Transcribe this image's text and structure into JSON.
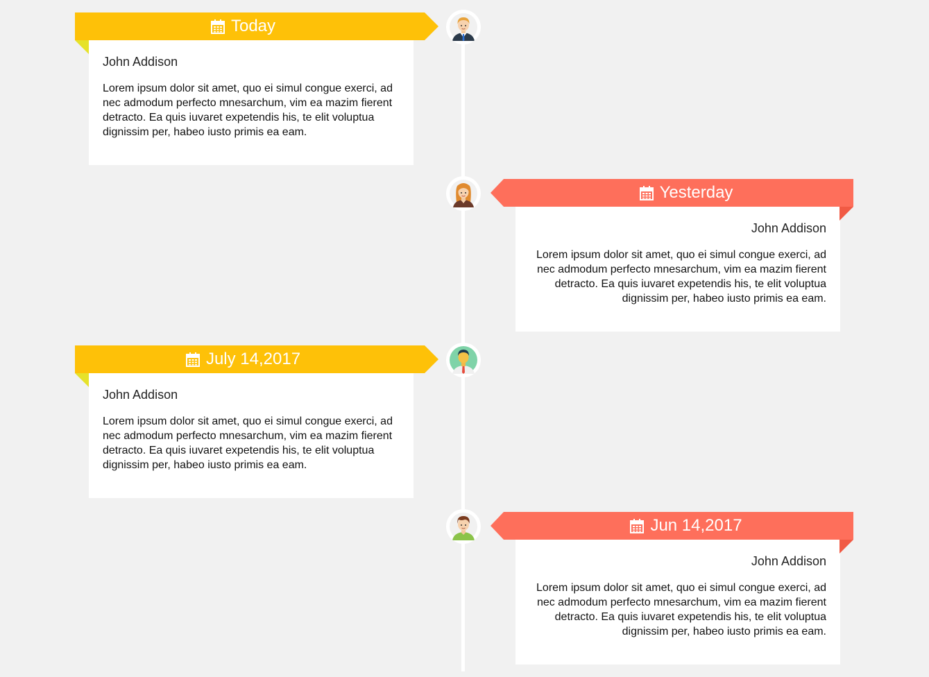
{
  "colors": {
    "background": "#f1f1f1",
    "yellow_ribbon": "#fec108",
    "yellow_fold": "#e6e22a",
    "coral_ribbon": "#fe6f5b",
    "coral_fold": "#f15a44"
  },
  "timeline": {
    "entries": [
      {
        "date_label": "Today",
        "name": "John Addison",
        "text": "Lorem ipsum dolor sit amet, quo ei simul congue exerci, ad nec admodum perfecto mnesarchum, vim ea mazim fierent detracto. Ea quis iuvaret expetendis his, te elit voluptua dignissim per, habeo iusto primis ea eam.",
        "side": "left",
        "avatar": "man-suit-avatar-icon",
        "icon": "calendar-icon"
      },
      {
        "date_label": "Yesterday",
        "name": "John Addison",
        "text": "Lorem ipsum dolor sit amet, quo ei simul congue exerci, ad nec admodum perfecto mnesarchum, vim ea mazim fierent detracto. Ea quis iuvaret expetendis his, te elit voluptua dignissim per, habeo iusto primis ea eam.",
        "side": "right",
        "avatar": "woman-avatar-icon",
        "icon": "calendar-icon"
      },
      {
        "date_label": "July 14,2017",
        "name": "John Addison",
        "text": "Lorem ipsum dolor sit amet, quo ei simul congue exerci, ad nec admodum perfecto mnesarchum, vim ea mazim fierent detracto. Ea quis iuvaret expetendis his, te elit voluptua dignissim per, habeo iusto primis ea eam.",
        "side": "left",
        "avatar": "man-green-avatar-icon",
        "icon": "calendar-icon"
      },
      {
        "date_label": "Jun 14,2017",
        "name": "John Addison",
        "text": "Lorem ipsum dolor sit amet, quo ei simul congue exerci, ad nec admodum perfecto mnesarchum, vim ea mazim fierent detracto. Ea quis iuvaret expetendis his, te elit voluptua dignissim per, habeo iusto primis ea eam.",
        "side": "right",
        "avatar": "young-man-avatar-icon",
        "icon": "calendar-icon"
      }
    ]
  }
}
